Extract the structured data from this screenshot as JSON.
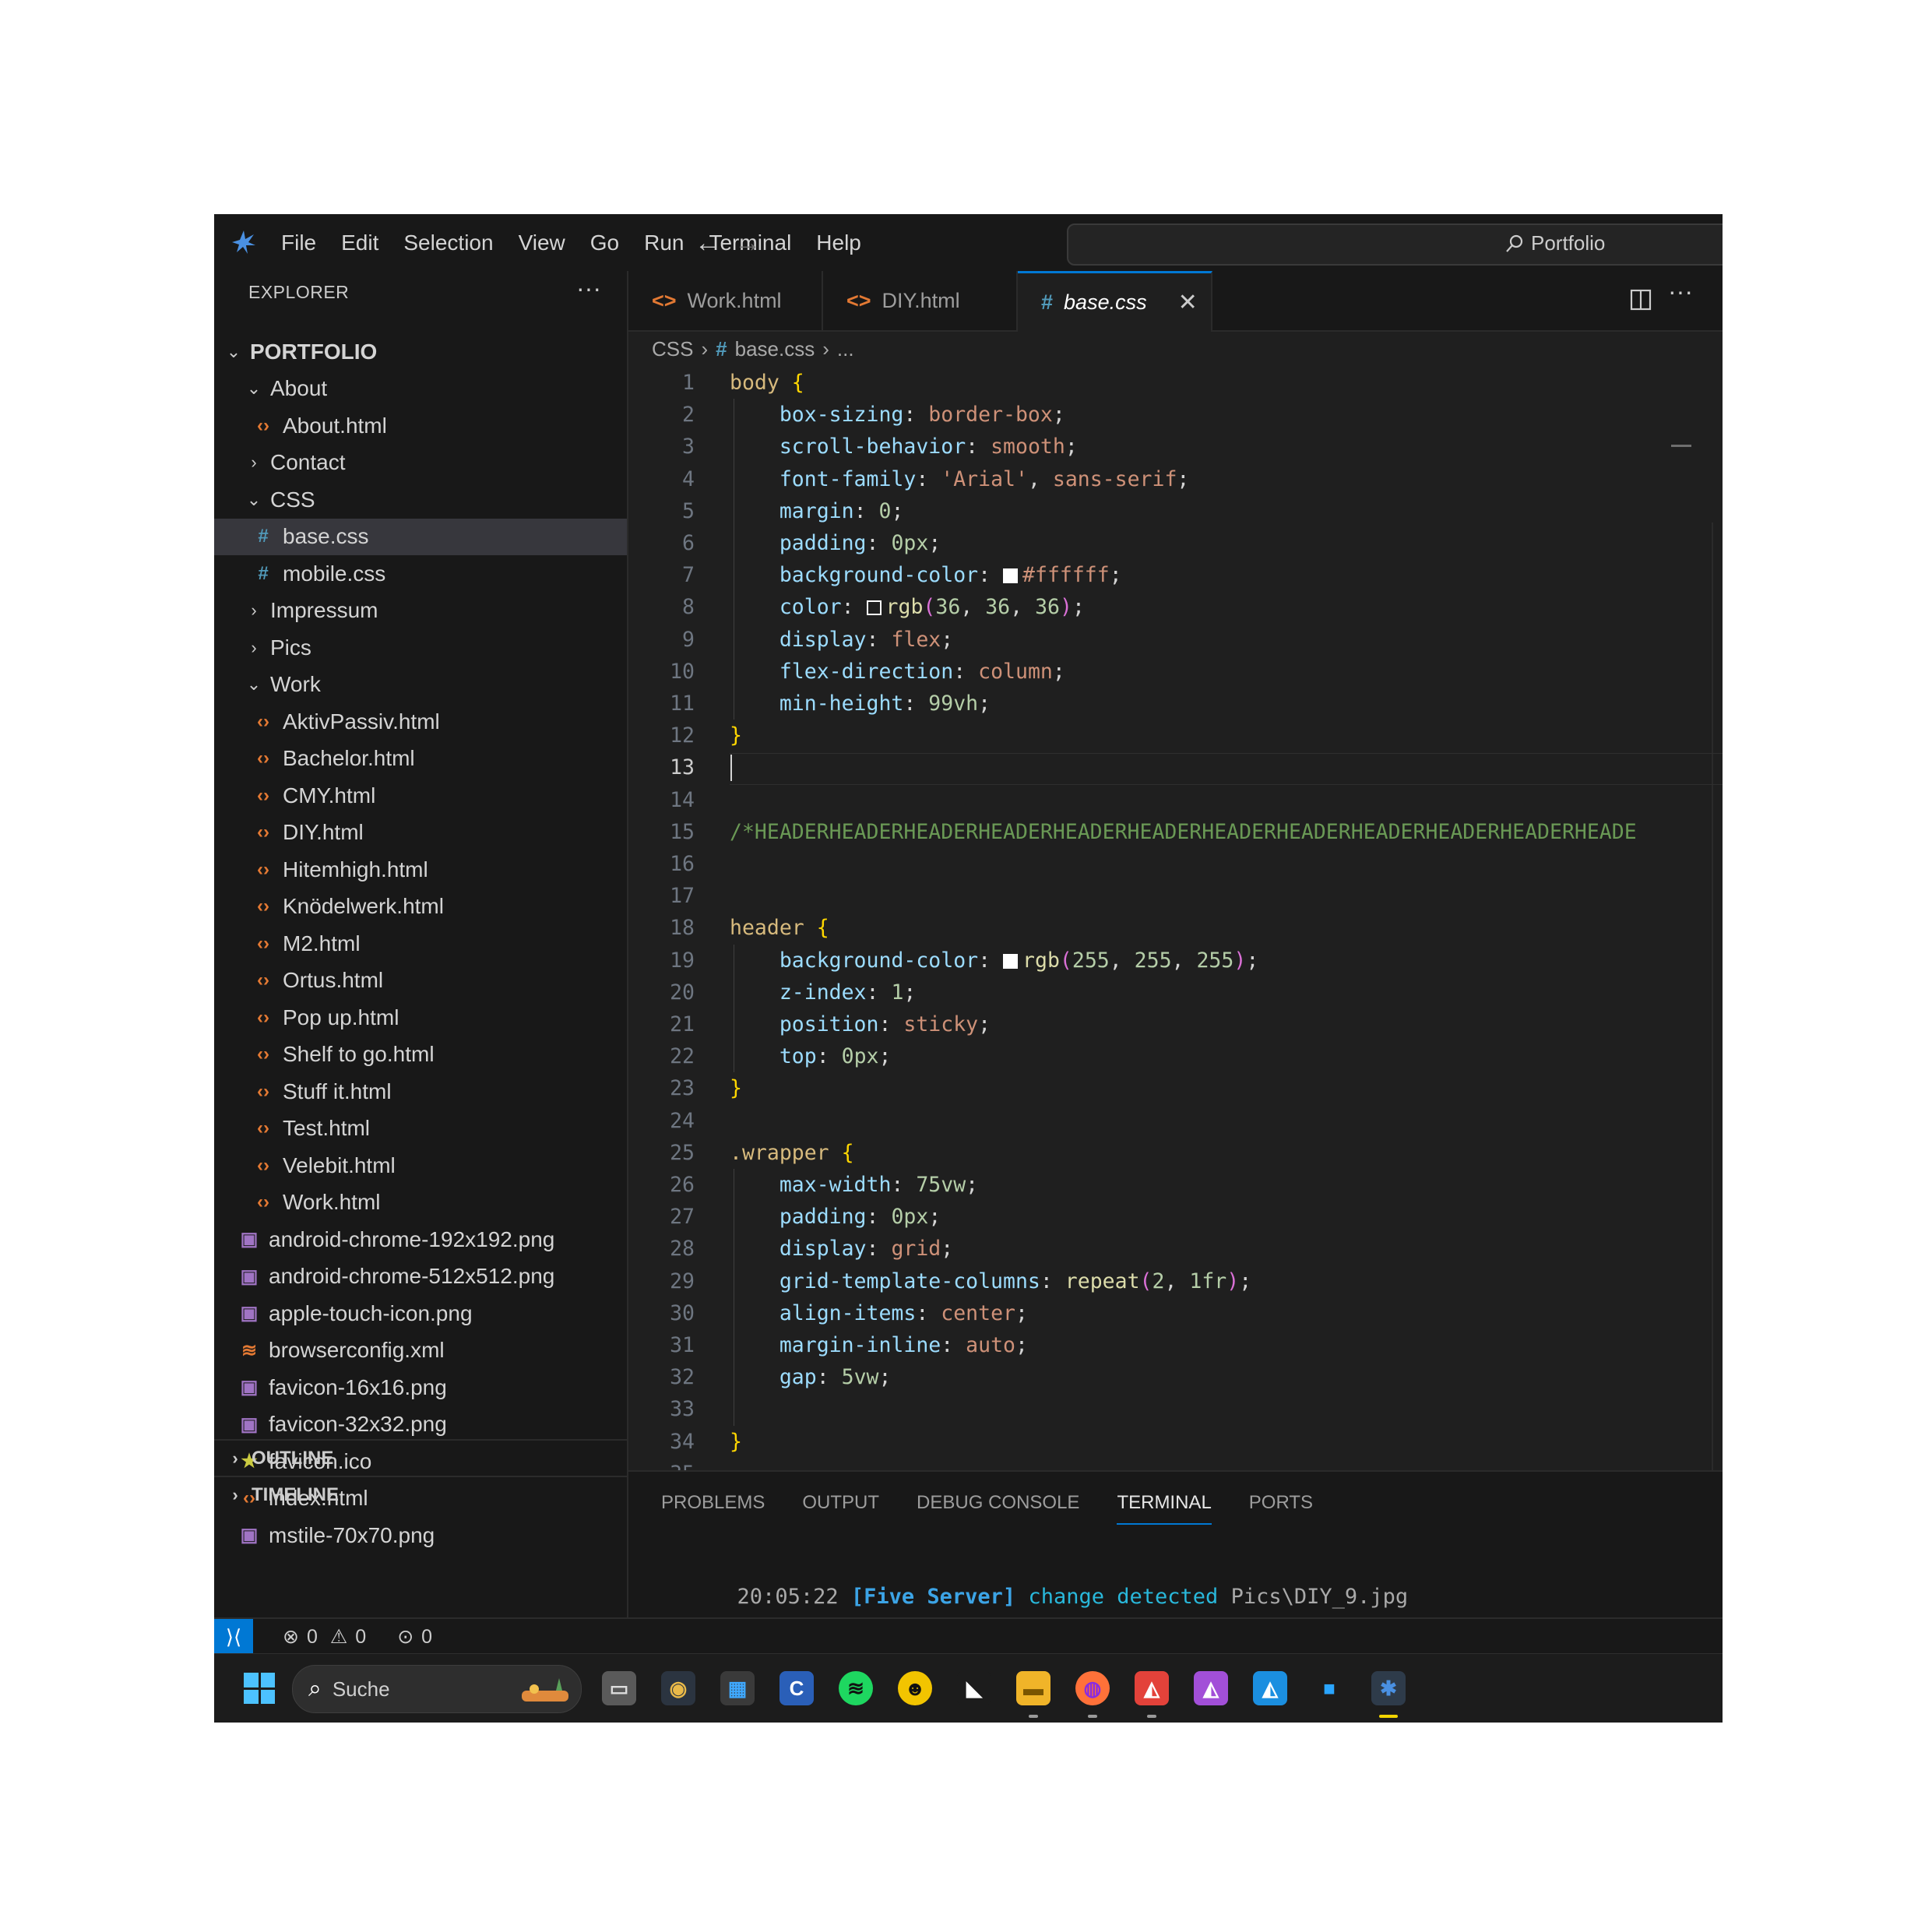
{
  "menu": [
    "File",
    "Edit",
    "Selection",
    "View",
    "Go",
    "Run",
    "Terminal",
    "Help"
  ],
  "command_center": {
    "label": "Portfolio"
  },
  "explorer": {
    "title": "EXPLORER",
    "more": "···",
    "root": "PORTFOLIO",
    "items": [
      {
        "label": "About",
        "kind": "folder-open",
        "depth": 1
      },
      {
        "label": "About.html",
        "kind": "html",
        "depth": 2
      },
      {
        "label": "Contact",
        "kind": "folder",
        "depth": 1
      },
      {
        "label": "CSS",
        "kind": "folder-open",
        "depth": 1
      },
      {
        "label": "base.css",
        "kind": "css",
        "depth": 2,
        "selected": true
      },
      {
        "label": "mobile.css",
        "kind": "css",
        "depth": 2
      },
      {
        "label": "Impressum",
        "kind": "folder",
        "depth": 1
      },
      {
        "label": "Pics",
        "kind": "folder",
        "depth": 1
      },
      {
        "label": "Work",
        "kind": "folder-open",
        "depth": 1
      },
      {
        "label": "AktivPassiv.html",
        "kind": "html",
        "depth": 2
      },
      {
        "label": "Bachelor.html",
        "kind": "html",
        "depth": 2
      },
      {
        "label": "CMY.html",
        "kind": "html",
        "depth": 2
      },
      {
        "label": "DIY.html",
        "kind": "html",
        "depth": 2
      },
      {
        "label": "Hitemhigh.html",
        "kind": "html",
        "depth": 2
      },
      {
        "label": "Knödelwerk.html",
        "kind": "html",
        "depth": 2
      },
      {
        "label": "M2.html",
        "kind": "html",
        "depth": 2
      },
      {
        "label": "Ortus.html",
        "kind": "html",
        "depth": 2
      },
      {
        "label": "Pop up.html",
        "kind": "html",
        "depth": 2
      },
      {
        "label": "Shelf to go.html",
        "kind": "html",
        "depth": 2
      },
      {
        "label": "Stuff it.html",
        "kind": "html",
        "depth": 2
      },
      {
        "label": "Test.html",
        "kind": "html",
        "depth": 2
      },
      {
        "label": "Velebit.html",
        "kind": "html",
        "depth": 2
      },
      {
        "label": "Work.html",
        "kind": "html",
        "depth": 2
      },
      {
        "label": "android-chrome-192x192.png",
        "kind": "png",
        "depth": 1
      },
      {
        "label": "android-chrome-512x512.png",
        "kind": "png",
        "depth": 1
      },
      {
        "label": "apple-touch-icon.png",
        "kind": "png",
        "depth": 1
      },
      {
        "label": "browserconfig.xml",
        "kind": "xml",
        "depth": 1
      },
      {
        "label": "favicon-16x16.png",
        "kind": "png",
        "depth": 1
      },
      {
        "label": "favicon-32x32.png",
        "kind": "png",
        "depth": 1
      },
      {
        "label": "favicon.ico",
        "kind": "ico",
        "depth": 1
      },
      {
        "label": "index.html",
        "kind": "html",
        "depth": 1
      },
      {
        "label": "mstile-70x70.png",
        "kind": "png",
        "depth": 1
      }
    ],
    "outline": "OUTLINE",
    "timeline": "TIMELINE"
  },
  "tabs": [
    {
      "label": "Work.html",
      "icon": "<>",
      "active": false
    },
    {
      "label": "DIY.html",
      "icon": "<>",
      "active": false
    },
    {
      "label": "base.css",
      "icon": "#",
      "active": true
    }
  ],
  "breadcrumb": {
    "folder": "CSS",
    "file_icon": "#",
    "file": "base.css",
    "more": "..."
  },
  "editor": {
    "current_line": 13,
    "lines": [
      [
        [
          "body ",
          "sel"
        ],
        [
          "{",
          "br"
        ]
      ],
      [
        [
          "    ",
          ""
        ],
        [
          "box-sizing",
          "prop"
        ],
        [
          ": ",
          "p"
        ],
        [
          "border-box",
          "val"
        ],
        [
          ";",
          "p"
        ]
      ],
      [
        [
          "    ",
          ""
        ],
        [
          "scroll-behavior",
          "prop"
        ],
        [
          ": ",
          "p"
        ],
        [
          "smooth",
          "val"
        ],
        [
          ";",
          "p"
        ]
      ],
      [
        [
          "    ",
          ""
        ],
        [
          "font-family",
          "prop"
        ],
        [
          ": ",
          "p"
        ],
        [
          "'Arial'",
          "val"
        ],
        [
          ", ",
          "p"
        ],
        [
          "sans-serif",
          "val"
        ],
        [
          ";",
          "p"
        ]
      ],
      [
        [
          "    ",
          ""
        ],
        [
          "margin",
          "prop"
        ],
        [
          ": ",
          "p"
        ],
        [
          "0",
          "num"
        ],
        [
          ";",
          "p"
        ]
      ],
      [
        [
          "    ",
          ""
        ],
        [
          "padding",
          "prop"
        ],
        [
          ": ",
          "p"
        ],
        [
          "0px",
          "num"
        ],
        [
          ";",
          "p"
        ]
      ],
      [
        [
          "    ",
          ""
        ],
        [
          "background-color",
          "prop"
        ],
        [
          ": ",
          "p"
        ],
        [
          "#ffffff",
          "swatch-white"
        ],
        [
          "#ffffff",
          "val"
        ],
        [
          ";",
          "p"
        ]
      ],
      [
        [
          "    ",
          ""
        ],
        [
          "color",
          "prop"
        ],
        [
          ": ",
          "p"
        ],
        [
          "rgb(36, 36, 36)",
          "swatch-dark"
        ],
        [
          "rgb",
          "fn"
        ],
        [
          "(",
          "br2"
        ],
        [
          "36",
          "num"
        ],
        [
          ", ",
          "p"
        ],
        [
          "36",
          "num"
        ],
        [
          ", ",
          "p"
        ],
        [
          "36",
          "num"
        ],
        [
          ")",
          "br2"
        ],
        [
          ";",
          "p"
        ]
      ],
      [
        [
          "    ",
          ""
        ],
        [
          "display",
          "prop"
        ],
        [
          ": ",
          "p"
        ],
        [
          "flex",
          "val"
        ],
        [
          ";",
          "p"
        ]
      ],
      [
        [
          "    ",
          ""
        ],
        [
          "flex-direction",
          "prop"
        ],
        [
          ": ",
          "p"
        ],
        [
          "column",
          "val"
        ],
        [
          ";",
          "p"
        ]
      ],
      [
        [
          "    ",
          ""
        ],
        [
          "min-height",
          "prop"
        ],
        [
          ": ",
          "p"
        ],
        [
          "99vh",
          "num"
        ],
        [
          ";",
          "p"
        ]
      ],
      [
        [
          "}",
          "br"
        ]
      ],
      [],
      [],
      [
        [
          "/*HEADERHEADERHEADERHEADERHEADERHEADERHEADERHEADERHEADERHEADERHEADERHEADE",
          "com"
        ]
      ],
      [],
      [],
      [
        [
          "header ",
          "sel"
        ],
        [
          "{",
          "br"
        ]
      ],
      [
        [
          "    ",
          ""
        ],
        [
          "background-color",
          "prop"
        ],
        [
          ": ",
          "p"
        ],
        [
          "rgb(255, 255, 255)",
          "swatch-white"
        ],
        [
          "rgb",
          "fn"
        ],
        [
          "(",
          "br2"
        ],
        [
          "255",
          "num"
        ],
        [
          ", ",
          "p"
        ],
        [
          "255",
          "num"
        ],
        [
          ", ",
          "p"
        ],
        [
          "255",
          "num"
        ],
        [
          ")",
          "br2"
        ],
        [
          ";",
          "p"
        ]
      ],
      [
        [
          "    ",
          ""
        ],
        [
          "z-index",
          "prop"
        ],
        [
          ": ",
          "p"
        ],
        [
          "1",
          "num"
        ],
        [
          ";",
          "p"
        ]
      ],
      [
        [
          "    ",
          ""
        ],
        [
          "position",
          "prop"
        ],
        [
          ": ",
          "p"
        ],
        [
          "sticky",
          "val"
        ],
        [
          ";",
          "p"
        ]
      ],
      [
        [
          "    ",
          ""
        ],
        [
          "top",
          "prop"
        ],
        [
          ": ",
          "p"
        ],
        [
          "0px",
          "num"
        ],
        [
          ";",
          "p"
        ]
      ],
      [
        [
          "}",
          "br"
        ]
      ],
      [],
      [
        [
          ".wrapper ",
          "sel"
        ],
        [
          "{",
          "br"
        ]
      ],
      [
        [
          "    ",
          ""
        ],
        [
          "max-width",
          "prop"
        ],
        [
          ": ",
          "p"
        ],
        [
          "75vw",
          "num"
        ],
        [
          ";",
          "p"
        ]
      ],
      [
        [
          "    ",
          ""
        ],
        [
          "padding",
          "prop"
        ],
        [
          ": ",
          "p"
        ],
        [
          "0px",
          "num"
        ],
        [
          ";",
          "p"
        ]
      ],
      [
        [
          "    ",
          ""
        ],
        [
          "display",
          "prop"
        ],
        [
          ": ",
          "p"
        ],
        [
          "grid",
          "val"
        ],
        [
          ";",
          "p"
        ]
      ],
      [
        [
          "    ",
          ""
        ],
        [
          "grid-template-columns",
          "prop"
        ],
        [
          ": ",
          "p"
        ],
        [
          "repeat",
          "fn"
        ],
        [
          "(",
          "br2"
        ],
        [
          "2",
          "num"
        ],
        [
          ", ",
          "p"
        ],
        [
          "1fr",
          "num"
        ],
        [
          ")",
          "br2"
        ],
        [
          ";",
          "p"
        ]
      ],
      [
        [
          "    ",
          ""
        ],
        [
          "align-items",
          "prop"
        ],
        [
          ": ",
          "p"
        ],
        [
          "center",
          "val"
        ],
        [
          ";",
          "p"
        ]
      ],
      [
        [
          "    ",
          ""
        ],
        [
          "margin-inline",
          "prop"
        ],
        [
          ": ",
          "p"
        ],
        [
          "auto",
          "val"
        ],
        [
          ";",
          "p"
        ]
      ],
      [
        [
          "    ",
          ""
        ],
        [
          "gap",
          "prop"
        ],
        [
          ": ",
          "p"
        ],
        [
          "5vw",
          "num"
        ],
        [
          ";",
          "p"
        ]
      ],
      [],
      [
        [
          "}",
          "br"
        ]
      ],
      []
    ]
  },
  "panel": {
    "tabs": [
      "PROBLEMS",
      "OUTPUT",
      "DEBUG CONSOLE",
      "TERMINAL",
      "PORTS"
    ],
    "active_tab": "TERMINAL",
    "terminal": {
      "time": "20:05:22",
      "server": "[Five Server]",
      "message": "change detected",
      "path": "Pics\\DIY_9.jpg"
    }
  },
  "status": {
    "errors": "0",
    "warnings": "0",
    "ports": "0"
  },
  "taskbar": {
    "search_label": "Suche",
    "apps": [
      "task-view",
      "davinci-resolve",
      "microsoft-store",
      "c-app",
      "spotify",
      "pac-app",
      "rhino",
      "file-explorer",
      "firefox",
      "affinity-publisher",
      "affinity-designer",
      "affinity-designer-blue",
      "camo",
      "vscodium"
    ]
  }
}
